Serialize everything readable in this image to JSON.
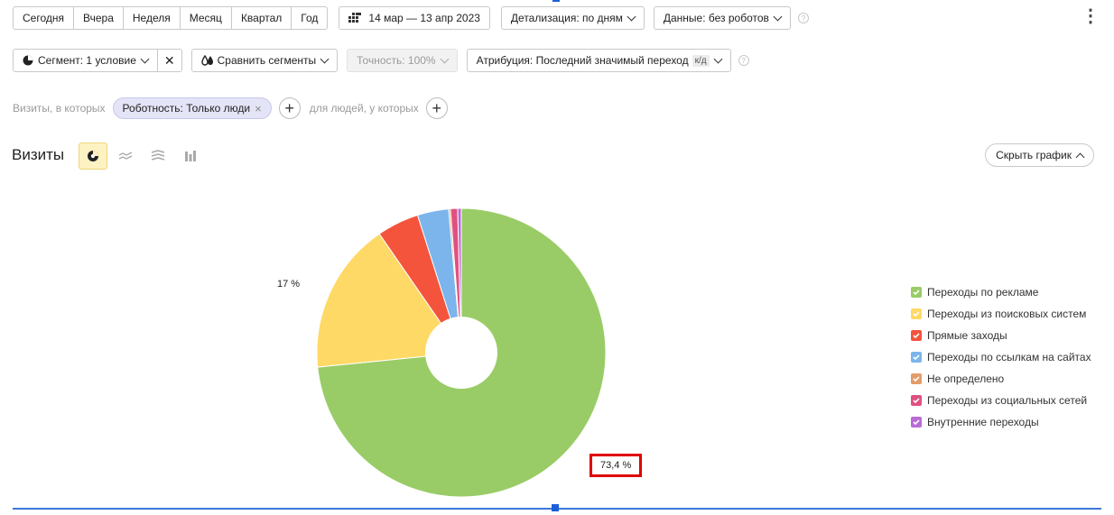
{
  "toolbar": {
    "periods": [
      "Сегодня",
      "Вчера",
      "Неделя",
      "Месяц",
      "Квартал",
      "Год"
    ],
    "date_range": "14 мар — 13 апр 2023",
    "detail_label": "Детализация: по дням",
    "data_label": "Данные: без роботов",
    "help_glyph": "?",
    "more_glyph": "⋮"
  },
  "toolbar2": {
    "segment_label": "Сегмент: 1 условие",
    "clear_glyph": "✕",
    "compare_label": "Сравнить сегменты",
    "accuracy_label": "Точность: 100%",
    "attribution_label": "Атрибуция: Последний значимый переход",
    "attribution_badge": "к/д"
  },
  "filters": {
    "visits_label": "Визиты, в которых",
    "chip_label": "Роботность: Только люди",
    "chip_close": "×",
    "people_label": "для людей, у которых",
    "plus_glyph": "+"
  },
  "chart_header": {
    "title": "Визиты",
    "hide_label": "Скрыть график"
  },
  "colors": {
    "ads": "#99cc66",
    "search": "#ffd966",
    "direct": "#f4543c",
    "links": "#7cb5ec",
    "undefined": "#e39c6b",
    "social": "#e0517f",
    "internal": "#b96bd6"
  },
  "icons": [
    "pie-chart-icon",
    "line-chart-icon",
    "stacked-area-icon",
    "column-chart-icon",
    "calendar-icon",
    "drops-icon",
    "segment-pie-icon"
  ],
  "chart_data": {
    "type": "pie",
    "categories": [
      "Переходы по рекламе",
      "Переходы из поисковых систем",
      "Прямые заходы",
      "Переходы по ссылкам на сайтах",
      "Не определено",
      "Переходы из социальных сетей",
      "Внутренние переходы"
    ],
    "values": [
      73.4,
      17,
      4.7,
      3.5,
      0.2,
      0.8,
      0.4
    ],
    "data_labels": [
      "73,4 %",
      "17 %"
    ],
    "donut": true,
    "legend_position": "right"
  }
}
